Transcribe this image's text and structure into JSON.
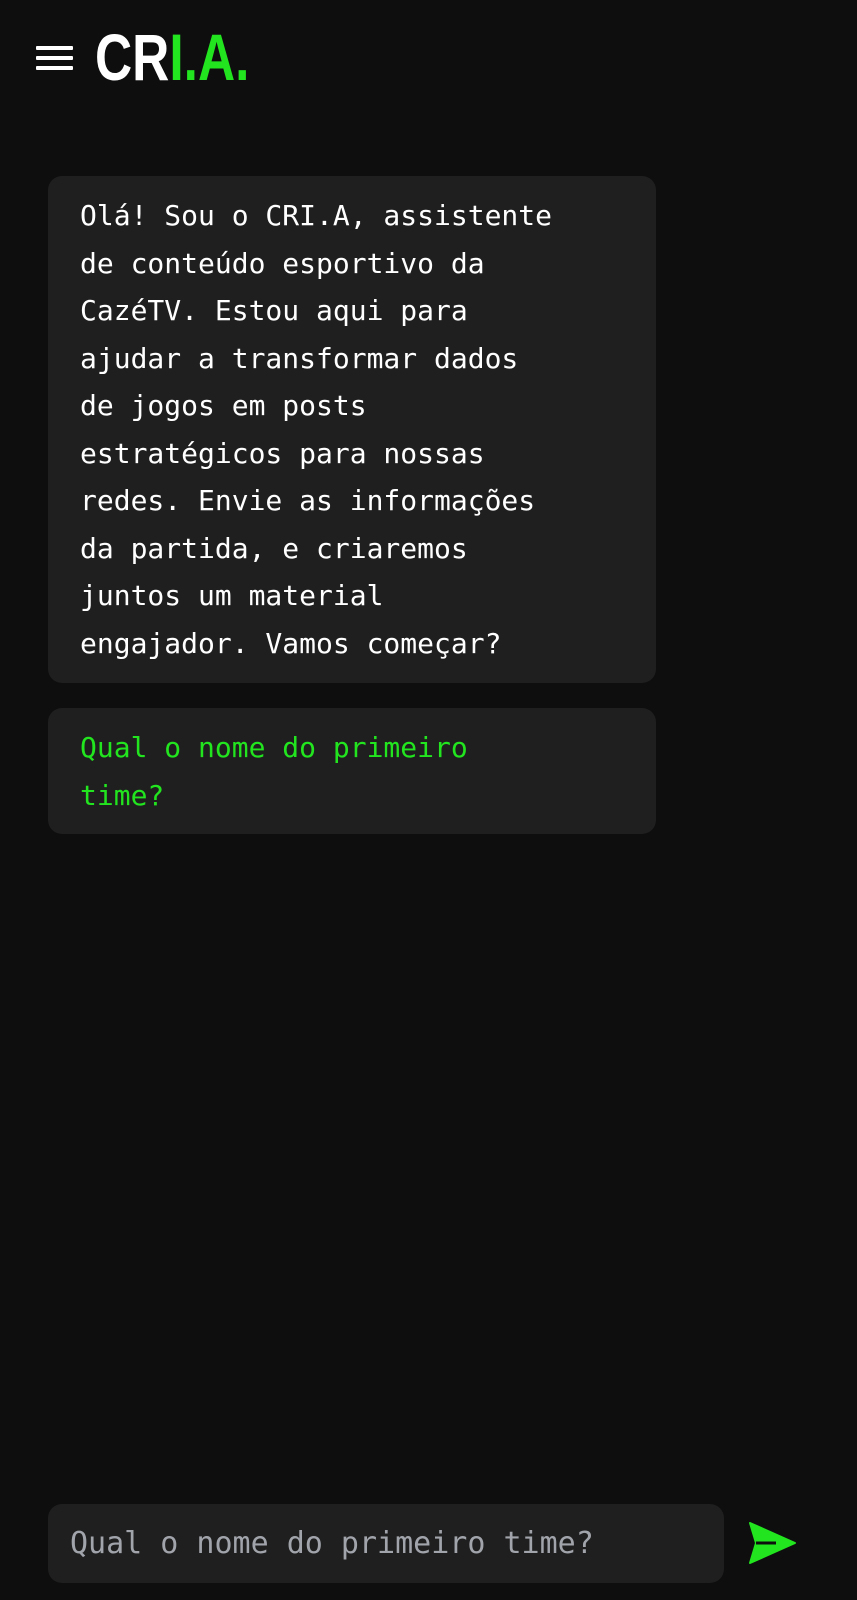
{
  "header": {
    "logo_part_white": "CR",
    "logo_part_green": "I.A."
  },
  "messages": [
    {
      "role": "assistant",
      "text": "Olá! Sou o CRI.A, assistente\nde conteúdo esportivo da\nCazéTV. Estou aqui para\najudar a transformar dados\nde jogos em posts\nestratégicos para nossas\nredes. Envie as informações\nda partida, e criaremos\njuntos um material\nengajador. Vamos começar?"
    },
    {
      "role": "assistant",
      "text": "Qual o nome do primeiro\ntime?"
    }
  ],
  "composer": {
    "placeholder": "Qual o nome do primeiro time?",
    "value": ""
  },
  "icons": {
    "menu": "hamburger-menu-icon",
    "send": "send-arrow-icon"
  },
  "colors": {
    "background": "#0e0e0e",
    "bubble": "#1f1f1f",
    "accent": "#22e51f",
    "text": "#ffffff",
    "placeholder": "#a1a4ab"
  }
}
